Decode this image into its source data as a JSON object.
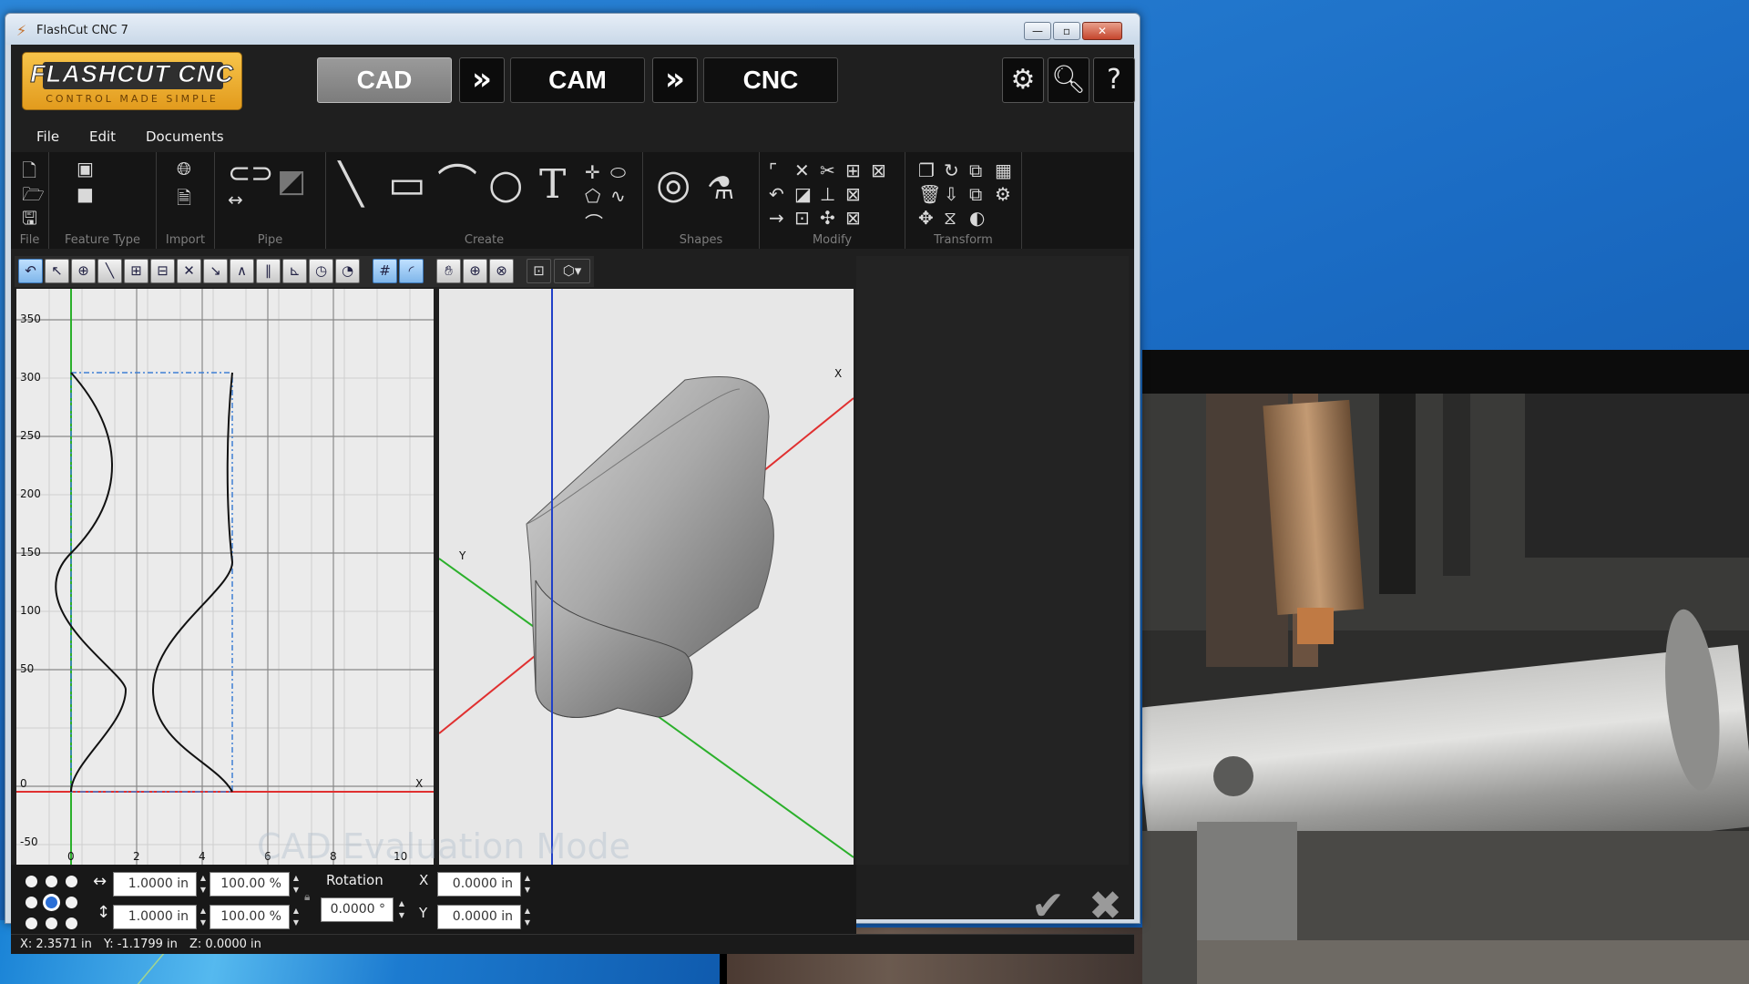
{
  "window": {
    "title": "FlashCut CNC 7",
    "min": "—",
    "max": "▫",
    "close": "✕"
  },
  "logo": {
    "line1": "FLASHCUT CNC",
    "line2": "CONTROL MADE SIMPLE"
  },
  "modes": [
    {
      "label": "CAD",
      "active": true
    },
    {
      "label": "CAM",
      "active": false
    },
    {
      "label": "CNC",
      "active": false
    }
  ],
  "menu": [
    "File",
    "Edit",
    "Documents"
  ],
  "ribbon_groups": [
    "File",
    "Feature Type",
    "Import",
    "Pipe",
    "Create",
    "Shapes",
    "Modify",
    "Transform"
  ],
  "view2d": {
    "y_ticks": [
      "350",
      "300",
      "250",
      "200",
      "150",
      "100",
      "50",
      "0",
      "-50"
    ],
    "x_ticks": [
      "0",
      "2",
      "4",
      "6",
      "8",
      "10"
    ],
    "x_axis_label": "X"
  },
  "view3d": {
    "x_axis_label": "X",
    "y_axis_label": "Y"
  },
  "watermark": "CAD Evaluation Mode",
  "bottom": {
    "width": "1.0000 in",
    "height": "1.0000 in",
    "width_pct": "100.00 %",
    "height_pct": "100.00 %",
    "rotation_label": "Rotation",
    "rotation": "0.0000 °",
    "x_label": "X",
    "y_label": "Y",
    "x": "0.0000 in",
    "y": "0.0000 in"
  },
  "status": {
    "x": "X: 2.3571 in",
    "y": "Y: -1.1799 in",
    "z": "Z: 0.0000 in"
  },
  "colors": {
    "accent": "#f0b432",
    "x_axis": "#e03030",
    "y_axis": "#2bb02b",
    "z_axis": "#2040c8",
    "guide": "#3f7fd4"
  }
}
